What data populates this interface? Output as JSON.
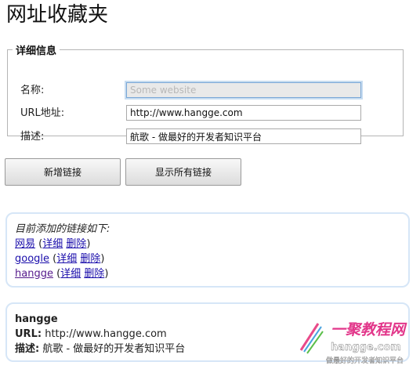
{
  "page": {
    "title": "网址收藏夹"
  },
  "details": {
    "legend": "详细信息",
    "fields": [
      {
        "label": "名称:",
        "value": "",
        "placeholder": "Some website"
      },
      {
        "label": "URL地址:",
        "value": "http://www.hangge.com",
        "placeholder": ""
      },
      {
        "label": "描述:",
        "value": "航歌 - 做最好的开发者知识平台",
        "placeholder": ""
      }
    ]
  },
  "buttons": {
    "add_label": "新增链接",
    "show_all_label": "显示所有链接"
  },
  "links_panel": {
    "intro": "目前添加的链接如下:",
    "items": [
      {
        "name": "网易",
        "detail": "详细",
        "delete": "删除"
      },
      {
        "name": "google",
        "detail": "详细",
        "delete": "删除"
      },
      {
        "name": "hangge",
        "detail": "详细",
        "delete": "删除"
      }
    ]
  },
  "detail_panel": {
    "name": "hangge",
    "url_label": "URL:",
    "url_value": "http://www.hangge.com",
    "desc_label": "描述:",
    "desc_value": "航歌 - 做最好的开发者知识平台"
  },
  "watermark": {
    "text_main": "一聚教程网",
    "text_domain": "hangge.com",
    "text_sub": "做最好的开发者知识平台"
  }
}
